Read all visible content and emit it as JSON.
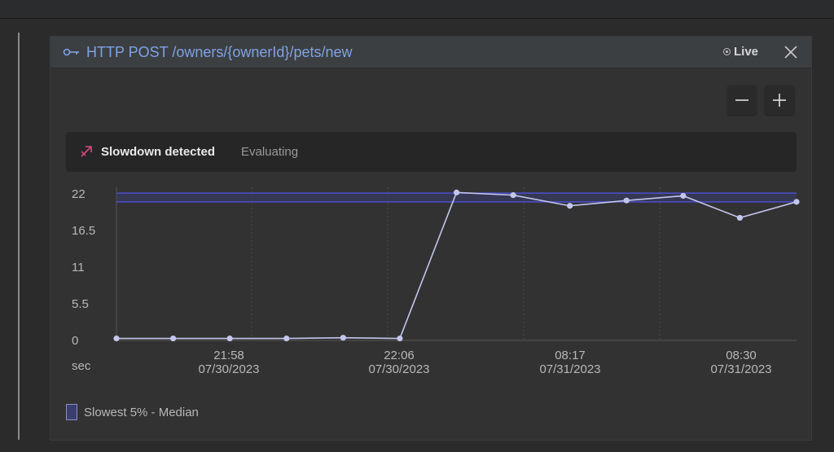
{
  "header": {
    "title": "HTTP POST /owners/{ownerId}/pets/new",
    "live_label": "Live"
  },
  "status": {
    "slowdown_label": "Slowdown detected",
    "evaluating_label": "Evaluating"
  },
  "legend": {
    "label": "Slowest 5% - Median"
  },
  "colors": {
    "accent": "#7ea3e8",
    "band": "#4c4fd0",
    "line": "#c3c6ec",
    "slowdown_icon": "#e0457b"
  },
  "chart_data": {
    "type": "line",
    "ylabel": "sec",
    "ylim": [
      0,
      22
    ],
    "y_ticks": [
      "22",
      "16.5",
      "11",
      "5.5",
      "0"
    ],
    "x_tick_labels": [
      {
        "time": "21:58",
        "date": "07/30/2023"
      },
      {
        "time": "22:06",
        "date": "07/30/2023"
      },
      {
        "time": "08:17",
        "date": "07/31/2023"
      },
      {
        "time": "08:30",
        "date": "07/31/2023"
      }
    ],
    "series": [
      {
        "values": [
          0.3,
          0.3,
          0.3,
          0.3,
          0.4,
          0.3,
          22.2,
          21.8,
          20.2,
          21.0,
          21.7,
          18.4,
          20.8
        ]
      }
    ],
    "band": {
      "low": 20.8,
      "high": 22.1
    },
    "grid": true
  }
}
